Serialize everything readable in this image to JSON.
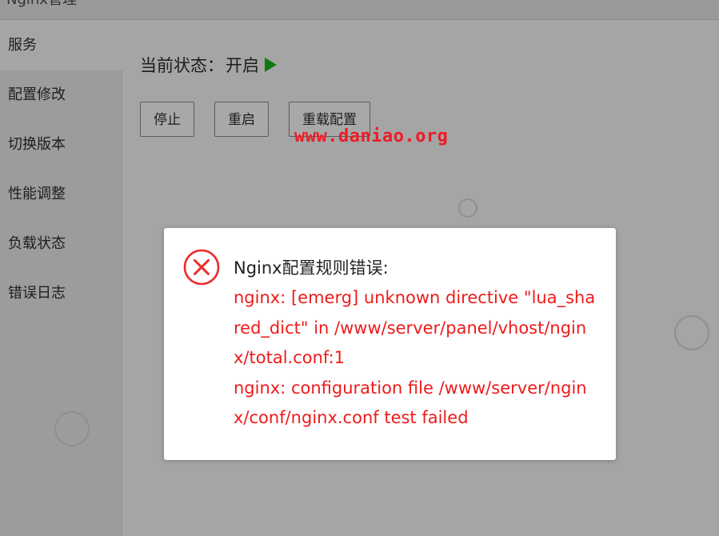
{
  "window": {
    "title": "Nginx管理"
  },
  "sidebar": {
    "items": [
      {
        "label": "服务"
      },
      {
        "label": "配置修改"
      },
      {
        "label": "切换版本"
      },
      {
        "label": "性能调整"
      },
      {
        "label": "负载状态"
      },
      {
        "label": "错误日志"
      }
    ]
  },
  "status": {
    "label": "当前状态：",
    "value": "开启"
  },
  "buttons": {
    "stop": "停止",
    "restart": "重启",
    "reload": "重载配置"
  },
  "watermark": "www.daniao.org",
  "dialog": {
    "title": "Nginx配置规则错误:",
    "lines": [
      "nginx: [emerg] unknown directive \"lua_shared_dict\" in /www/server/panel/vhost/nginx/total.conf:1",
      "nginx: configuration file /www/server/nginx/conf/nginx.conf test failed"
    ]
  },
  "colors": {
    "overlay_bg": "#a5a5a5",
    "sidebar_bg": "#9c9c9c",
    "error_red": "#ee1b1b",
    "watermark_red": "#ee1c24",
    "status_green": "#0e7a12"
  },
  "icons": {
    "status": "play-icon",
    "dialog": "error-circle-x-icon"
  }
}
